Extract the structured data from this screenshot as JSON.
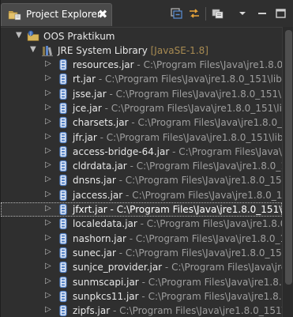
{
  "view": {
    "title": "Project Explorer",
    "close_glyph": "✖"
  },
  "icons": {
    "view_icon": "folder-icon",
    "collapse_all": "collapse-all-icon",
    "link_with_editor": "link-with-editor-icon",
    "focus_on_working_set": "working-set-icon",
    "view_menu": "view-menu-icon",
    "minimize": "minimize-icon",
    "maximize": "maximize-icon"
  },
  "tree": {
    "project": {
      "name": "OOS Praktikum",
      "expanded": true
    },
    "library": {
      "name": "JRE System Library",
      "tag": "[JavaSE-1.8]",
      "expanded": true
    },
    "jars": [
      {
        "name": "resources.jar",
        "path": "C:\\Program Files\\Java\\jre1.8.0_151\\lib"
      },
      {
        "name": "rt.jar",
        "path": "C:\\Program Files\\Java\\jre1.8.0_151\\lib"
      },
      {
        "name": "jsse.jar",
        "path": "C:\\Program Files\\Java\\jre1.8.0_151\\lib"
      },
      {
        "name": "jce.jar",
        "path": "C:\\Program Files\\Java\\jre1.8.0_151\\lib"
      },
      {
        "name": "charsets.jar",
        "path": "C:\\Program Files\\Java\\jre1.8.0_151\\lib"
      },
      {
        "name": "jfr.jar",
        "path": "C:\\Program Files\\Java\\jre1.8.0_151\\lib"
      },
      {
        "name": "access-bridge-64.jar",
        "path": "C:\\Program Files\\Java\\jre1.8.0_151"
      },
      {
        "name": "cldrdata.jar",
        "path": "C:\\Program Files\\Java\\jre1.8.0_151\\lib"
      },
      {
        "name": "dnsns.jar",
        "path": "C:\\Program Files\\Java\\jre1.8.0_151\\lib"
      },
      {
        "name": "jaccess.jar",
        "path": "C:\\Program Files\\Java\\jre1.8.0_151\\lib"
      },
      {
        "name": "jfxrt.jar",
        "path": "C:\\Program Files\\Java\\jre1.8.0_151\\lib\\e",
        "selected": true
      },
      {
        "name": "localedata.jar",
        "path": "C:\\Program Files\\Java\\jre1.8.0_151\\lib"
      },
      {
        "name": "nashorn.jar",
        "path": "C:\\Program Files\\Java\\jre1.8.0_151\\lib"
      },
      {
        "name": "sunec.jar",
        "path": "C:\\Program Files\\Java\\jre1.8.0_151\\lib\\"
      },
      {
        "name": "sunjce_provider.jar",
        "path": "C:\\Program Files\\Java\\jre1.8.0_1"
      },
      {
        "name": "sunmscapi.jar",
        "path": "C:\\Program Files\\Java\\jre1.8.0_151\\"
      },
      {
        "name": "sunpkcs11.jar",
        "path": "C:\\Program Files\\Java\\jre1.8.0_151\\l"
      },
      {
        "name": "zipfs.jar",
        "path": "C:\\Program Files\\Java\\jre1.8.0_151\\lib\\"
      }
    ],
    "separator": " - "
  },
  "colors": {
    "background": "#2f2f2f",
    "tab_active": "#4a4a4a",
    "text": "#e0e0e0",
    "path_text": "#9e9e9e",
    "library_tag": "#a88b52",
    "jar_icon_blue": "#4f7fc6"
  }
}
